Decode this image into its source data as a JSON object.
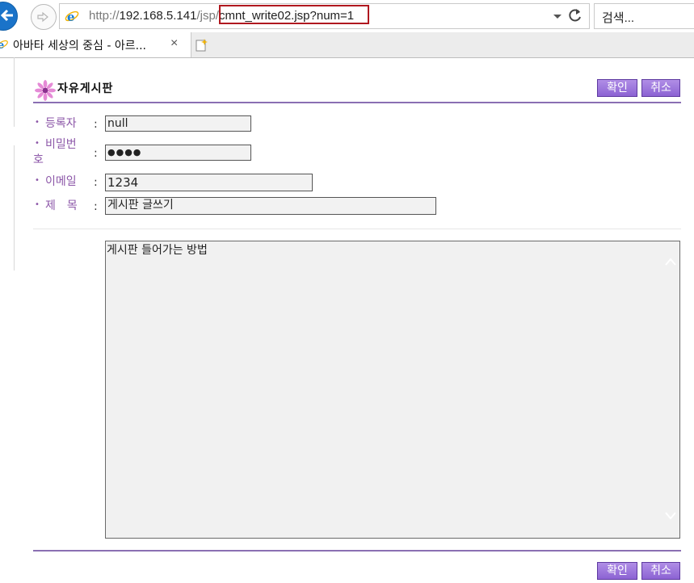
{
  "browser": {
    "url_prefix": "http://",
    "url_host": "192.168.5.141",
    "url_path": "/jsp/",
    "url_highlight": "cmnt_write02.jsp?num=1",
    "search_placeholder": "검색...",
    "tab_title": "아바타 세상의 중심 - 아르...",
    "tab_close": "×"
  },
  "board": {
    "title": "자유게시판",
    "confirm_label": "확인",
    "cancel_label": "취소"
  },
  "form": {
    "author_label": "등록자",
    "author_value": "null",
    "password_label_line1": "비밀번",
    "password_label_line2": "호",
    "password_value": "●●●●",
    "email_label": "이메일",
    "email_value": "1234",
    "subject_label": "제　목",
    "subject_value": "게시판 글쓰기",
    "colon": ":",
    "bullet": "•",
    "content_value": "게시판 들어가는 방법"
  },
  "colors": {
    "accent": "#8a6fb3",
    "label": "#8c57a8",
    "button": "#9b76dc",
    "url_highlight_border": "#b0181f"
  }
}
